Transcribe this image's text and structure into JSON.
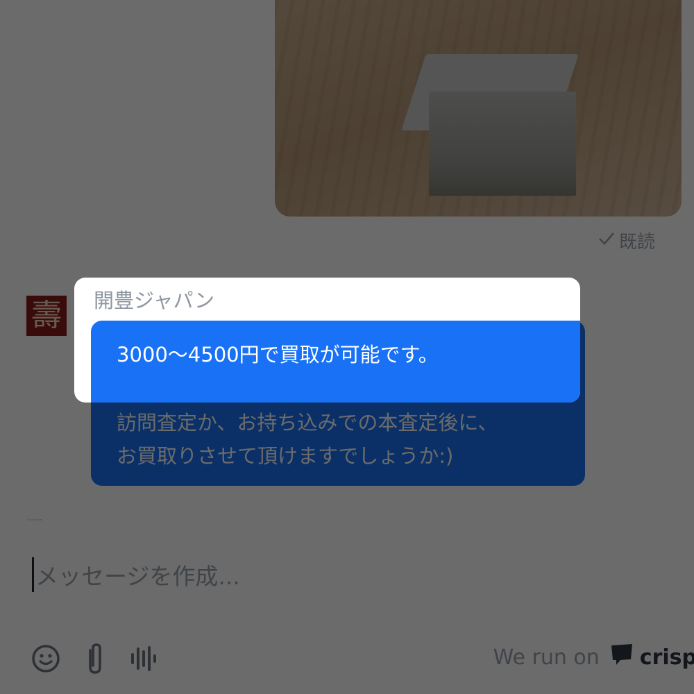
{
  "chat": {
    "read_receipt": "既読",
    "sender_name": "開豊ジャパン",
    "avatar_glyph": "壽",
    "message_lines": [
      "3000〜4500円で買取が可能です。",
      "訪問査定か、お持ち込みでの本査定後に、",
      "お買取りさせて頂けますでしょうか:)"
    ]
  },
  "composer": {
    "placeholder": "メッセージを作成..."
  },
  "toolbar": {
    "icons": [
      "emoji-icon",
      "attachment-icon",
      "audio-wave-icon"
    ]
  },
  "branding": {
    "prefix": "We run on",
    "name": "crisp"
  },
  "colors": {
    "bubble": "#1972f5",
    "overlay": "rgba(0,0,0,0.58)",
    "avatar": "#8a1c1c"
  }
}
